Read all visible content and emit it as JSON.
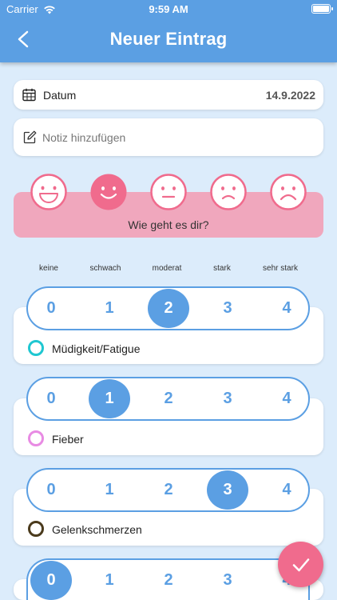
{
  "status_bar": {
    "carrier": "Carrier",
    "time": "9:59 AM"
  },
  "header": {
    "title": "Neuer Eintrag",
    "back_icon": "chevron-left-icon"
  },
  "date": {
    "label": "Datum",
    "value": "14.9.2022",
    "icon": "calendar-icon"
  },
  "note": {
    "placeholder": "Notiz hinzufügen",
    "value": "",
    "icon": "edit-note-icon"
  },
  "mood": {
    "question": "Wie geht es dir?",
    "selected_index": 1,
    "faces": [
      "very-happy-face-icon",
      "happy-face-icon",
      "neutral-face-icon",
      "sad-face-icon",
      "very-sad-face-icon"
    ]
  },
  "scale_labels": [
    "keine",
    "schwach",
    "moderat",
    "stark",
    "sehr stark"
  ],
  "rating_options": [
    "0",
    "1",
    "2",
    "3",
    "4"
  ],
  "symptoms": [
    {
      "name": "Müdigkeit/Fatigue",
      "color": "#1fc7d1",
      "selected": 2
    },
    {
      "name": "Fieber",
      "color": "#e88be3",
      "selected": 1
    },
    {
      "name": "Gelenkschmerzen",
      "color": "#4a3a1c",
      "selected": 3
    },
    {
      "name": "",
      "color": "#5b9fe3",
      "selected": 0
    }
  ],
  "colors": {
    "header": "#5b9fe3",
    "accent": "#5b9fe3",
    "mood": "#f0a7bd",
    "mood_face": "#f06b8d",
    "fab": "#f06b8d"
  },
  "fab": {
    "icon": "checkmark-icon"
  }
}
